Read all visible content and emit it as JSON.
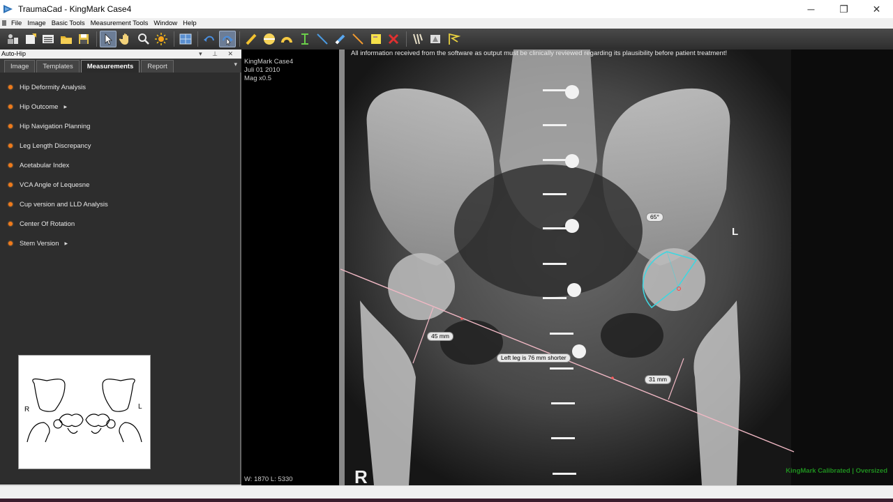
{
  "window": {
    "title": "TraumaCad - KingMark Case4",
    "minimize": "─",
    "restore": "❐",
    "close": "✕"
  },
  "menu": [
    "File",
    "Image",
    "Basic Tools",
    "Measurement Tools",
    "Window",
    "Help"
  ],
  "toolbar": {
    "icons": [
      "patient-icon",
      "open-image-icon",
      "list-icon",
      "folder-icon",
      "save-icon",
      "select-arrow-icon",
      "pan-hand-icon",
      "zoom-icon",
      "brightness-icon",
      "layout-grid-icon",
      "undo-icon",
      "redo-icon",
      "pencil-icon",
      "circle-icon",
      "arc-icon",
      "distance-icon",
      "line-icon",
      "eraser-icon",
      "ruler-line-icon",
      "note-icon",
      "delete-icon",
      "femur-icon",
      "stamp-icon",
      "angle-flag-icon"
    ],
    "active_icon": "redo-icon"
  },
  "panel": {
    "title": "Auto-Hip",
    "controls": "▾ ⊥ ✕",
    "tabs": [
      "Image",
      "Templates",
      "Measurements",
      "Report"
    ],
    "active_tab": "Measurements",
    "tab_menu": "▾",
    "items": [
      {
        "label": "Hip Deformity Analysis",
        "submenu": false
      },
      {
        "label": "Hip Outcome",
        "submenu": true
      },
      {
        "label": "Hip Navigation Planning",
        "submenu": false
      },
      {
        "label": "Leg Length Discrepancy",
        "submenu": false
      },
      {
        "label": "Acetabular Index",
        "submenu": false
      },
      {
        "label": "VCA Angle of Lequesne",
        "submenu": false
      },
      {
        "label": "Cup version and LLD Analysis",
        "submenu": false
      },
      {
        "label": "Center Of Rotation",
        "submenu": false
      },
      {
        "label": "Stem Version",
        "submenu": true
      }
    ],
    "thumbnail": {
      "left_label": "R",
      "right_label": "L"
    }
  },
  "viewer": {
    "case": "KingMark Case4",
    "date": "Juli 01 2010",
    "mag": "Mag x0.5",
    "warning": "All information received from the software as output must be clinically reviewed regarding its plausibility before patient treatment!",
    "window_level": "W: 1870 L: 5330",
    "calibration": "KingMark Calibrated | Oversized",
    "side_left": "L",
    "side_right": "R",
    "measurements": {
      "angle": "65°",
      "right_distance": "45 mm",
      "left_distance": "31 mm",
      "summary": "Left leg is 76 mm shorter"
    }
  },
  "colors": {
    "accent_orange": "#f07a1a",
    "measure_pink": "#f0b8c4",
    "measure_cyan": "#3fd6e0",
    "calibration_green": "#1f8f1f"
  }
}
